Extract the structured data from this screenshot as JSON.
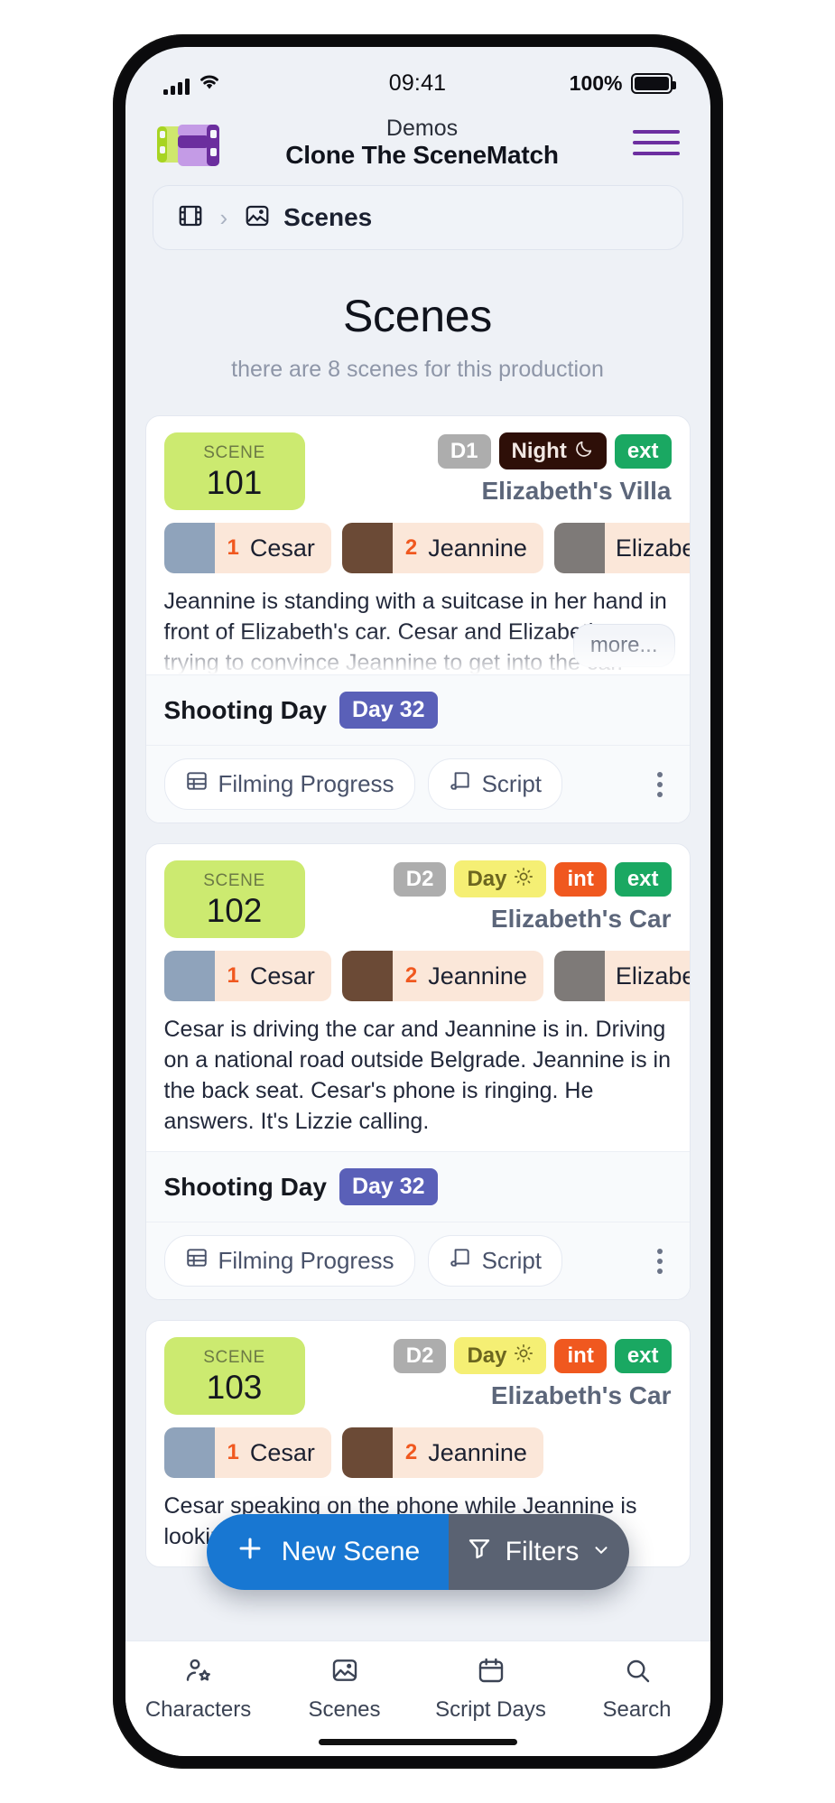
{
  "status_bar": {
    "time": "09:41",
    "battery_percent": "100%",
    "signal_icon": "signal-bars-icon",
    "wifi_icon": "wifi-icon",
    "battery_icon": "battery-full-icon"
  },
  "header": {
    "logo_icon": "film-strip-logo-icon",
    "subtitle": "Demos",
    "title": "Clone The SceneMatch",
    "menu_icon": "hamburger-menu-icon"
  },
  "breadcrumb": {
    "film_icon": "film-icon",
    "separator": "›",
    "image_icon": "image-icon",
    "label": "Scenes"
  },
  "page": {
    "title": "Scenes",
    "subtitle": "there are 8 scenes for this production"
  },
  "labels": {
    "scene_kicker": "SCENE",
    "shooting_day": "Shooting Day",
    "more": "more...",
    "filming_progress": "Filming Progress",
    "script": "Script",
    "kebab_icon": "kebab-menu-icon",
    "progress_icon": "grid-icon",
    "script_icon": "script-icon"
  },
  "scenes": [
    {
      "number": "101",
      "day_badge": "D1",
      "time_badge": "Night",
      "time_icon": "moon-icon",
      "time_kind": "night",
      "int": null,
      "ext": "ext",
      "location": "Elizabeth's Villa",
      "characters": [
        {
          "order": "1",
          "name": "Cesar"
        },
        {
          "order": "2",
          "name": "Jeannine"
        },
        {
          "order": "",
          "name": "Elizabeth"
        }
      ],
      "description": "Jeannine is standing with a suitcase in her hand in front of Elizabeth's car. Cesar and Elizabeth are trying to convince Jeannine to get into the car. Jeannine is angry. She's agitated.",
      "clamped": true,
      "shooting_day": "Day 32"
    },
    {
      "number": "102",
      "day_badge": "D2",
      "time_badge": "Day",
      "time_icon": "sun-icon",
      "time_kind": "day",
      "int": "int",
      "ext": "ext",
      "location": "Elizabeth's Car",
      "characters": [
        {
          "order": "1",
          "name": "Cesar"
        },
        {
          "order": "2",
          "name": "Jeannine"
        },
        {
          "order": "",
          "name": "Elizabeth"
        }
      ],
      "description": "Cesar is driving the car and Jeannine is in. Driving on a national road outside Belgrade. Jeannine is in the back seat. Cesar's phone is ringing. He answers. It's Lizzie calling.",
      "clamped": false,
      "shooting_day": "Day 32"
    },
    {
      "number": "103",
      "day_badge": "D2",
      "time_badge": "Day",
      "time_icon": "sun-icon",
      "time_kind": "day",
      "int": "int",
      "ext": "ext",
      "location": "Elizabeth's Car",
      "characters": [
        {
          "order": "1",
          "name": "Cesar"
        },
        {
          "order": "2",
          "name": "Jeannine"
        }
      ],
      "description": "Cesar speaking on the phone while Jeannine is looking outside",
      "clamped": false,
      "shooting_day": ""
    }
  ],
  "fab": {
    "new_scene": "New Scene",
    "plus_icon": "plus-icon",
    "filters": "Filters",
    "filter_icon": "funnel-icon",
    "chevron_icon": "chevron-down-icon"
  },
  "tabbar": [
    {
      "label": "Characters",
      "icon": "user-star-icon"
    },
    {
      "label": "Scenes",
      "icon": "image-icon"
    },
    {
      "label": "Script Days",
      "icon": "calendar-icon"
    },
    {
      "label": "Search",
      "icon": "search-icon"
    }
  ],
  "colors": {
    "accent_blue": "#1877d2",
    "scene_green": "#ccea70",
    "day_badge": "#5a60b8",
    "int_orange": "#f0581f",
    "ext_green": "#1aa862",
    "night": "#2e0f08",
    "day_yellow": "#f5ef74"
  }
}
